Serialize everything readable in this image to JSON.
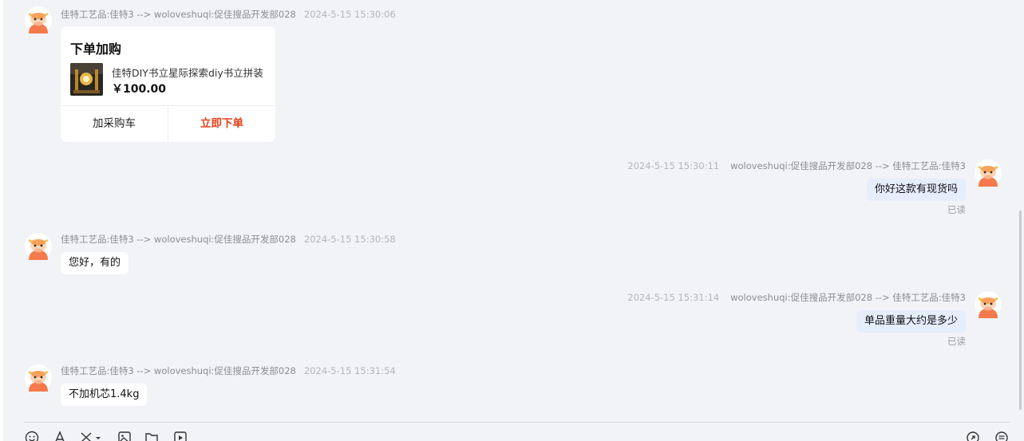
{
  "messages": {
    "m1": {
      "sender": "佳特工艺品:佳特3 --> woloveshuqi:促佳搜品开发部028",
      "time": "2024-5-15 15:30:06",
      "card": {
        "title": "下单加购",
        "product_name": "佳特DIY书立星际探索diy书立拼装",
        "price": "￥100.00",
        "cart_button": "加采购车",
        "order_button": "立即下单"
      }
    },
    "m2": {
      "time": "2024-5-15 15:30:11",
      "sender": "woloveshuqi:促佳搜品开发部028 --> 佳特工艺品:佳特3",
      "text": "你好这款有现货吗",
      "status": "已读"
    },
    "m3": {
      "sender": "佳特工艺品:佳特3 --> woloveshuqi:促佳搜品开发部028",
      "time": "2024-5-15 15:30:58",
      "text": "您好，有的"
    },
    "m4": {
      "time": "2024-5-15 15:31:14",
      "sender": "woloveshuqi:促佳搜品开发部028 --> 佳特工艺品:佳特3",
      "text": "单品重量大约是多少",
      "status": "已读"
    },
    "m5": {
      "sender": "佳特工艺品:佳特3 --> woloveshuqi:促佳搜品开发部028",
      "time": "2024-5-15 15:31:54",
      "text": "不加机芯1.4kg"
    }
  },
  "toolbar": {
    "icons": [
      "emoji-icon",
      "font-icon",
      "scissors-icon",
      "image-icon",
      "folder-icon",
      "video-icon",
      "refresh-icon",
      "quick-reply-icon"
    ]
  },
  "colors": {
    "background": "#f2f3f6",
    "incoming_bubble": "#ffffff",
    "outgoing_bubble": "#e6edfd",
    "order_accent": "#e8401a",
    "avatar_orange": "#f47a4b"
  }
}
